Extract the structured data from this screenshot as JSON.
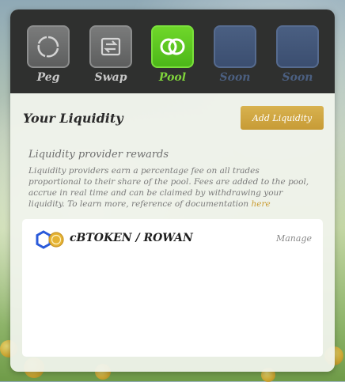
{
  "nav": {
    "items": [
      {
        "label": "Peg",
        "icon": "peg-circle-icon",
        "state": "inactive"
      },
      {
        "label": "Swap",
        "icon": "swap-arrows-icon",
        "state": "inactive"
      },
      {
        "label": "Pool",
        "icon": "pool-rings-icon",
        "state": "active"
      },
      {
        "label": "Soon",
        "icon": "placeholder-icon",
        "state": "disabled"
      },
      {
        "label": "Soon",
        "icon": "placeholder-icon",
        "state": "disabled"
      }
    ]
  },
  "header": {
    "title": "Your Liquidity",
    "add_button": "Add Liquidity"
  },
  "rewards": {
    "title": "Liquidity provider rewards",
    "text": "Liquidity providers earn a percentage fee on all trades proportional to their share of the pool. Fees are added to the pool, accrue in real time and can be claimed by withdrawing your liquidity. To learn more, reference of documentation ",
    "link": "here"
  },
  "pools": [
    {
      "pair": "cBTOKEN / ROWAN",
      "action": "Manage",
      "icons": [
        "chainlink-hex-icon",
        "rowan-coin-icon"
      ]
    }
  ],
  "colors": {
    "accent_gold": "#c99a2e",
    "active_green": "#5cc520",
    "nav_bg": "#2f302f"
  }
}
